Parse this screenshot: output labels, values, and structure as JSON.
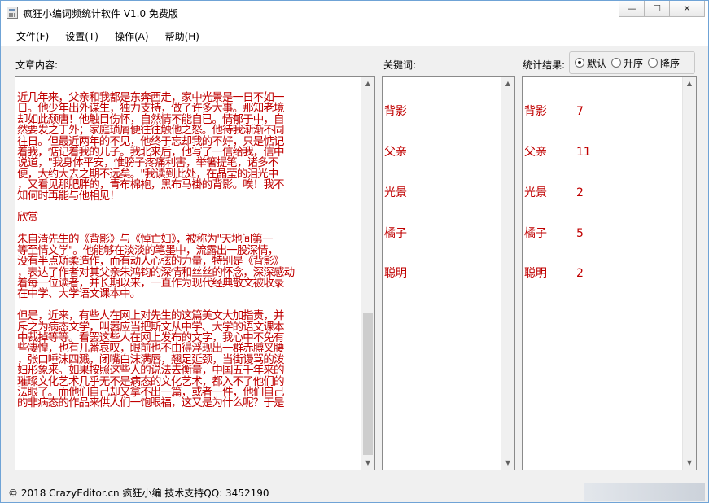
{
  "window": {
    "title": "疯狂小编词频统计软件 V1.0 免费版",
    "controls": {
      "minimize": "—",
      "maximize": "☐",
      "close": "✕"
    }
  },
  "menu": [
    {
      "label": "文件(F)"
    },
    {
      "label": "设置(T)"
    },
    {
      "label": "操作(A)"
    },
    {
      "label": "帮助(H)"
    }
  ],
  "labels": {
    "article": "文章内容:",
    "keywords": "关键词:",
    "results": "统计结果:"
  },
  "sort": {
    "options": [
      "默认",
      "升序",
      "降序"
    ],
    "selected": "默认"
  },
  "article_text": "近几年来，父亲和我都是东奔西走，家中光景是一日不如一\n日。他少年出外谋生，独力支持，做了许多大事。那知老境\n却如此颓唐！他触目伤怀，自然情不能自已。情郁于中，自\n然要发之于外；家庭琐屑便往往触他之怒。他待我渐渐不同\n往日。但最近两年的不见，他终于忘却我的不好，只是惦记\n着我，惦记着我的儿子。我北来后，他写了一信给我，信中\n说道，\"我身体平安，惟膀子疼痛利害，举箸提笔，诸多不\n便，大约大去之期不远矣。\"我读到此处，在晶莹的泪光中\n，又看见那肥胖的，青布棉袍，黑布马褂的背影。唉！我不\n知何时再能与他相见！\n\n欣赏\n\n朱自清先生的《背影》与《悼亡妇》，被称为\"天地间第一\n等至情文学\"。他能够在淡淡的笔墨中，流露出一股深情，\n没有半点矫柔造作，而有动人心弦的力量，特别是《背影》\n，表达了作者对其父亲朱鸿钧的深情和丝丝的怀念，深深感动\n着每一位读者，并长期以来，一直作为现代经典散文被收录\n在中学、大学语文课本中。\n\n但是，近来，有些人在网上对先生的这篇美文大加指责，并\n斥之为病态文学，叫嚣应当把斯文从中学、大学的语文课本\n中裁掉等等。看罢这些人在网上发布的文字，我心中不免有\n些凄惶，也有几番哀叹，眼前也不由得浮现出一群赤膊叉腰\n，张口唾沫四溅，闭嘴白沫满唇，翘足延颈，当街谩骂的泼\n妇形象来。如果按照这些人的说法去衡量，中国五千年来的\n璀璨文化艺术几乎无不是病态的文化艺术，都入不了他们的\n法眼了。而他们自己却又拿不出一篇，或者一件，他们自己\n的非病态的作品来供人们一饱眼福，这又是为什么呢？于是",
  "keywords": [
    "背影",
    "父亲",
    "光景",
    "橘子",
    "聪明"
  ],
  "results": [
    {
      "word": "背影",
      "count": "7"
    },
    {
      "word": "父亲",
      "count": "11"
    },
    {
      "word": "光景",
      "count": "2"
    },
    {
      "word": "橘子",
      "count": "5"
    },
    {
      "word": "聪明",
      "count": "2"
    }
  ],
  "status": "© 2018 CrazyEditor.cn 疯狂小编   技术支持QQ: 3452190",
  "colors": {
    "text_red": "#c00000",
    "border_blue": "#6fa3d6"
  }
}
